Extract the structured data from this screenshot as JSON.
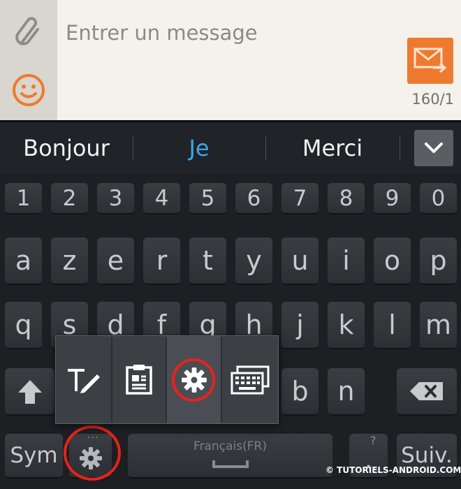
{
  "composer": {
    "placeholder": "Entrer un message",
    "char_counter": "160/1",
    "attach_icon": "paperclip-icon",
    "emoji_icon": "smiley-icon",
    "send_icon": "send-message-icon",
    "accent": "#ee7a2f"
  },
  "suggestions": {
    "items": [
      "Bonjour",
      "Je",
      "Merci"
    ],
    "active_index": 1,
    "active_color": "#3ea6e8",
    "expand_icon": "chevron-down-icon"
  },
  "keyboard": {
    "number_row": [
      "1",
      "2",
      "3",
      "4",
      "5",
      "6",
      "7",
      "8",
      "9",
      "0"
    ],
    "row1": [
      "a",
      "z",
      "e",
      "r",
      "t",
      "y",
      "u",
      "i",
      "o",
      "p"
    ],
    "row2": [
      "q",
      "s",
      "d",
      "f",
      "g",
      "h",
      "j",
      "k",
      "l",
      "m"
    ],
    "row3_visible": [
      "b",
      "n"
    ],
    "sym_label": "Sym",
    "space_label": "Français(FR)",
    "next_label": "Suiv.",
    "period_label": ".",
    "question_hint": "?",
    "settings_icon": "gear-icon",
    "shift_icon": "shift-arrow-icon",
    "backspace_icon": "backspace-icon"
  },
  "popup": {
    "items": [
      "handwriting-icon",
      "clipboard-icon",
      "settings-gear-icon",
      "keyboard-icon"
    ],
    "selected_index": 2,
    "highlight_color": "#e8221c"
  },
  "watermark": "© TUTORIELS-ANDROID.COM"
}
